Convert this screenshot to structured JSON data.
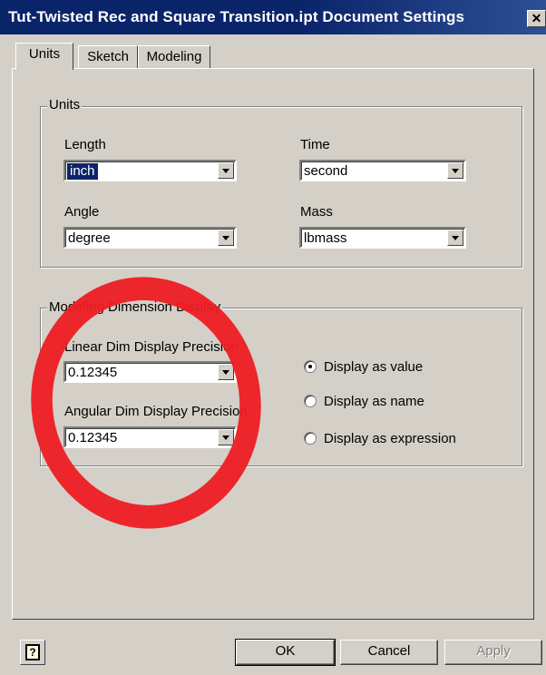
{
  "window": {
    "title": "Tut-Twisted Rec and Square Transition.ipt Document Settings",
    "close_label": "✕"
  },
  "tabs": [
    {
      "label": "Units",
      "active": true
    },
    {
      "label": "Sketch",
      "active": false
    },
    {
      "label": "Modeling",
      "active": false
    }
  ],
  "units_group": {
    "label": "Units",
    "length": {
      "label": "Length",
      "value": "inch"
    },
    "time": {
      "label": "Time",
      "value": "second"
    },
    "angle": {
      "label": "Angle",
      "value": "degree"
    },
    "mass": {
      "label": "Mass",
      "value": "lbmass"
    }
  },
  "modeling_group": {
    "label": "Modeling Dimension Display",
    "linear": {
      "label": "Linear Dim Display Precision",
      "value": "0.12345"
    },
    "angular": {
      "label": "Angular Dim Display Precision",
      "value": "0.12345"
    },
    "display_options": [
      {
        "label": "Display as value",
        "selected": true
      },
      {
        "label": "Display as name",
        "selected": false
      },
      {
        "label": "Display as expression",
        "selected": false
      }
    ]
  },
  "footer": {
    "help_label": "?",
    "ok_label": "OK",
    "cancel_label": "Cancel",
    "apply_label": "Apply"
  },
  "colors": {
    "annotation_ring": "#ee1c24",
    "titlebar": "#0a246a",
    "dialog_face": "#d4d0c8"
  },
  "icons": {
    "help": "help-icon",
    "close": "close-icon",
    "dropdown": "chevron-down-icon"
  }
}
